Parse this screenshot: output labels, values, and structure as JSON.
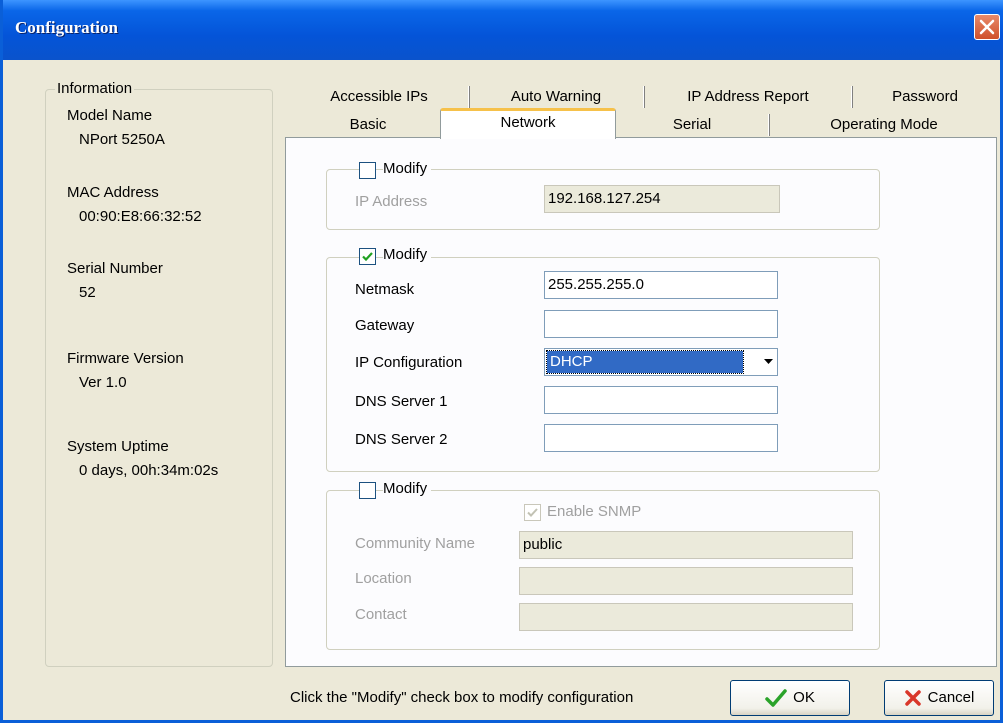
{
  "window": {
    "title": "Configuration"
  },
  "info": {
    "group_label": "Information",
    "items": [
      {
        "label": "Model Name",
        "value": "NPort 5250A"
      },
      {
        "label": "MAC Address",
        "value": "00:90:E8:66:32:52"
      },
      {
        "label": "Serial Number",
        "value": "52"
      },
      {
        "label": "Firmware Version",
        "value": "Ver 1.0"
      },
      {
        "label": "System Uptime",
        "value": "0 days, 00h:34m:02s"
      }
    ]
  },
  "tabs": {
    "back_row": [
      "Accessible IPs",
      "Auto Warning",
      "IP Address Report",
      "Password"
    ],
    "front_row": [
      "Basic",
      "Network",
      "Serial",
      "Operating Mode"
    ],
    "active": "Network"
  },
  "network": {
    "ip_group": {
      "modify_label": "Modify",
      "modify_checked": false,
      "ip_label": "IP Address",
      "ip_value": "192.168.127.254"
    },
    "net_group": {
      "modify_label": "Modify",
      "modify_checked": true,
      "netmask_label": "Netmask",
      "netmask_value": "255.255.255.0",
      "gateway_label": "Gateway",
      "gateway_value": "",
      "ipconfig_label": "IP Configuration",
      "ipconfig_value": "DHCP",
      "dns1_label": "DNS Server 1",
      "dns1_value": "",
      "dns2_label": "DNS Server 2",
      "dns2_value": ""
    },
    "snmp_group": {
      "modify_label": "Modify",
      "modify_checked": false,
      "enable_label": "Enable SNMP",
      "enable_checked": true,
      "community_label": "Community Name",
      "community_value": "public",
      "location_label": "Location",
      "location_value": "",
      "contact_label": "Contact",
      "contact_value": ""
    }
  },
  "footer": {
    "hint": "Click the \"Modify\" check box to modify configuration",
    "ok_label": "OK",
    "cancel_label": "Cancel"
  },
  "colors": {
    "titlebar": "#0454d8",
    "selection": "#316ac5",
    "tab_highlight": "#f6c14a"
  }
}
